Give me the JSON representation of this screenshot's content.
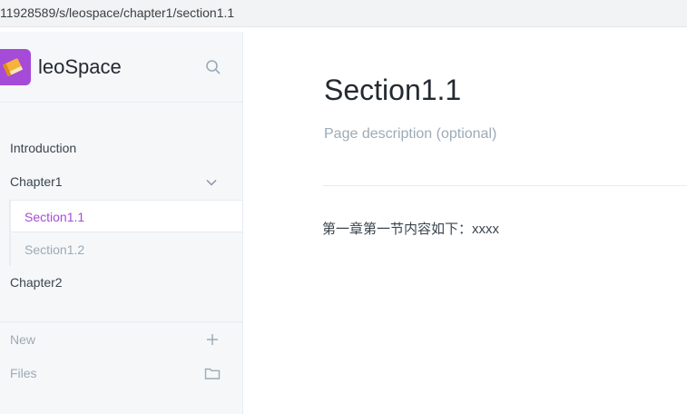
{
  "browser": {
    "url": "11928589/s/leospace/chapter1/section1.1"
  },
  "sidebar": {
    "brand": "leoSpace",
    "nav": {
      "introduction": "Introduction",
      "chapter1": "Chapter1",
      "section1_1": "Section1.1",
      "section1_2": "Section1.2",
      "chapter2": "Chapter2"
    },
    "tools": {
      "new": "New",
      "files": "Files"
    }
  },
  "main": {
    "title": "Section1.1",
    "description_placeholder": "Page description (optional)",
    "body": "第一章第一节内容如下：xxxx"
  },
  "colors": {
    "accent": "#a64bd8",
    "muted": "#9daab6",
    "text": "#242a31",
    "sidebar_bg": "#f5f7f9"
  },
  "icons": [
    "book-logo-icon",
    "search-icon",
    "chevron-down-icon",
    "plus-icon",
    "folder-icon"
  ]
}
